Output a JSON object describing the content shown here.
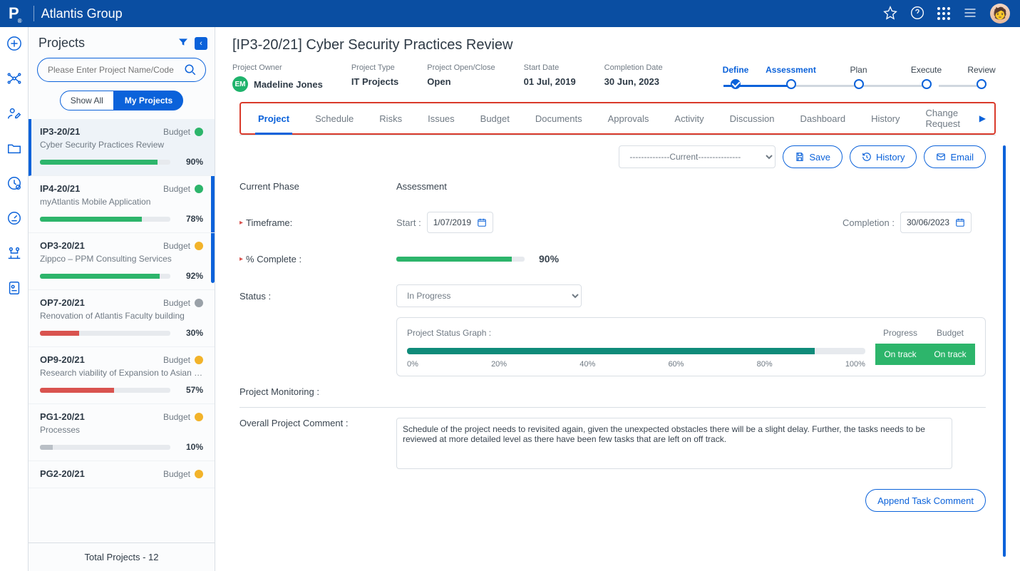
{
  "header": {
    "brand": "Atlantis Group",
    "logo": "P"
  },
  "sidebar": {
    "title": "Projects",
    "search_placeholder": "Please Enter Project Name/Code",
    "toggle": {
      "all": "Show All",
      "mine": "My Projects"
    },
    "footer": "Total Projects - 12",
    "budget_label": "Budget",
    "projects": [
      {
        "code": "IP3-20/21",
        "name": "Cyber Security Practices Review",
        "pct": "90%",
        "bar_w": "90%",
        "bar_color": "#2db56b",
        "dot": "#2db56b",
        "active": true
      },
      {
        "code": "IP4-20/21",
        "name": "myAtlantis Mobile Application",
        "pct": "78%",
        "bar_w": "78%",
        "bar_color": "#2db56b",
        "dot": "#2db56b",
        "active": false
      },
      {
        "code": "OP3-20/21",
        "name": "Zippco – PPM Consulting Services",
        "pct": "92%",
        "bar_w": "92%",
        "bar_color": "#2db56b",
        "dot": "#f2b32a",
        "active": false
      },
      {
        "code": "OP7-20/21",
        "name": "Renovation of Atlantis Faculty building",
        "pct": "30%",
        "bar_w": "30%",
        "bar_color": "#d9534f",
        "dot": "#9aa1a8",
        "active": false
      },
      {
        "code": "OP9-20/21",
        "name": "Research viability of Expansion to Asian M...",
        "pct": "57%",
        "bar_w": "57%",
        "bar_color": "#d9534f",
        "dot": "#f2b32a",
        "active": false
      },
      {
        "code": "PG1-20/21",
        "name": "Processes",
        "pct": "10%",
        "bar_w": "10%",
        "bar_color": "#b9bfc6",
        "dot": "#f2b32a",
        "active": false
      },
      {
        "code": "PG2-20/21",
        "name": "",
        "pct": "",
        "bar_w": "0%",
        "bar_color": "#b9bfc6",
        "dot": "#f2b32a",
        "active": false
      }
    ]
  },
  "main": {
    "title": "[IP3-20/21] Cyber Security Practices Review",
    "meta": {
      "owner_label": "Project Owner",
      "owner": "Madeline Jones",
      "owner_initials": "EM",
      "type_label": "Project Type",
      "type": "IT Projects",
      "open_label": "Project Open/Close",
      "open": "Open",
      "start_label": "Start Date",
      "start": "01 Jul, 2019",
      "end_label": "Completion Date",
      "end": "30 Jun, 2023"
    },
    "phases": [
      "Define",
      "Assessment",
      "Plan",
      "Execute",
      "Review"
    ],
    "tabs": [
      "Project",
      "Schedule",
      "Risks",
      "Issues",
      "Budget",
      "Documents",
      "Approvals",
      "Activity",
      "Discussion",
      "Dashboard",
      "History",
      "Change Request"
    ],
    "toolbar": {
      "select": "--------------Current---------------",
      "save": "Save",
      "history": "History",
      "email": "Email"
    },
    "form": {
      "phase_label": "Current Phase",
      "phase_value": "Assessment",
      "timeframe_label": "Timeframe:",
      "start_prefix": "Start :",
      "start_val": "1/07/2019",
      "completion_prefix": "Completion :",
      "completion_val": "30/06/2023",
      "pct_label": "% Complete :",
      "pct_val": "90%",
      "status_label": "Status :",
      "status_val": "In Progress",
      "sg_title": "Project Status Graph :",
      "sg_ticks": [
        "0%",
        "20%",
        "40%",
        "60%",
        "80%",
        "100%"
      ],
      "sg_progress_h": "Progress",
      "sg_budget_h": "Budget",
      "sg_progress_v": "On track",
      "sg_budget_v": "On track",
      "monitor_label": "Project Monitoring :",
      "comment_label": "Overall Project Comment :",
      "comment_val": "Schedule of the project needs to revisited again, given the unexpected obstacles there will be a slight delay. Further, the tasks needs to be reviewed at more detailed level as there have been few tasks that are left on off track.",
      "append": "Append Task Comment"
    }
  }
}
